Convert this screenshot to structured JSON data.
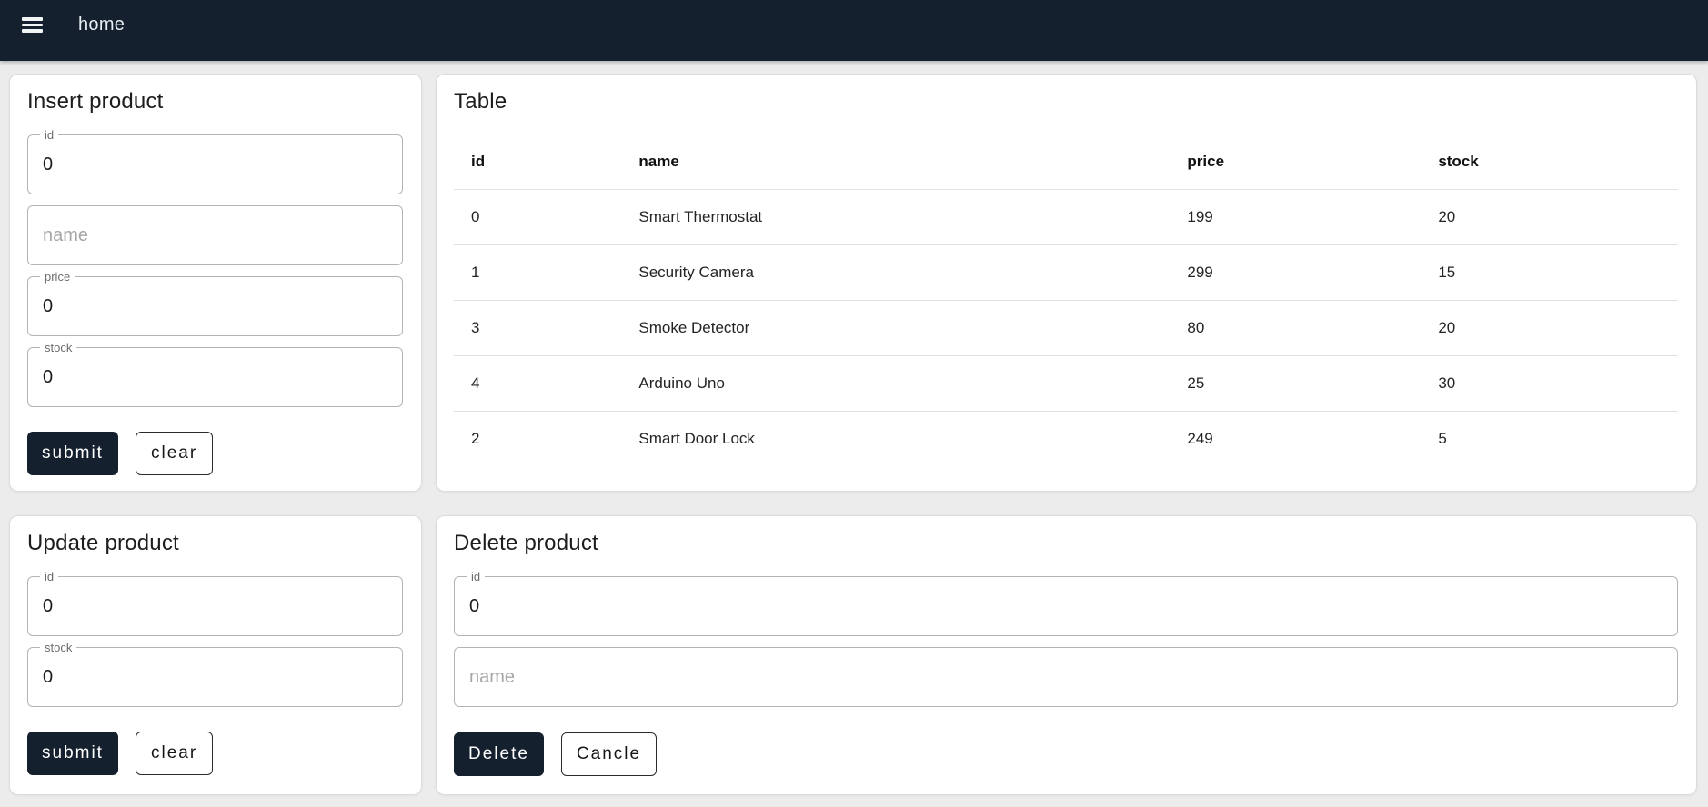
{
  "colors": {
    "app_bar_bg": "#14202e",
    "primary_button_bg": "#14202e",
    "page_bg": "#ececec"
  },
  "app_bar": {
    "menu_icon": "hamburger-menu-icon",
    "title": "home"
  },
  "insert_card": {
    "title": "Insert product",
    "id_field": {
      "label": "id",
      "value": "0"
    },
    "name_field": {
      "placeholder": "name",
      "value": ""
    },
    "price_field": {
      "label": "price",
      "value": "0"
    },
    "stock_field": {
      "label": "stock",
      "value": "0"
    },
    "submit_button": "submit",
    "clear_button": "clear"
  },
  "table_card": {
    "title": "Table",
    "columns": [
      "id",
      "name",
      "price",
      "stock"
    ],
    "rows": [
      [
        "0",
        "Smart Thermostat",
        "199",
        "20"
      ],
      [
        "1",
        "Security Camera",
        "299",
        "15"
      ],
      [
        "3",
        "Smoke Detector",
        "80",
        "20"
      ],
      [
        "4",
        "Arduino Uno",
        "25",
        "30"
      ],
      [
        "2",
        "Smart Door Lock",
        "249",
        "5"
      ]
    ]
  },
  "update_card": {
    "title": "Update product",
    "id_field": {
      "label": "id",
      "value": "0"
    },
    "stock_field": {
      "label": "stock",
      "value": "0"
    },
    "submit_button": "submit",
    "clear_button": "clear"
  },
  "delete_card": {
    "title": "Delete product",
    "id_field": {
      "label": "id",
      "value": "0"
    },
    "name_field": {
      "placeholder": "name",
      "value": ""
    },
    "delete_button": "Delete",
    "cancel_button": "Cancle"
  }
}
